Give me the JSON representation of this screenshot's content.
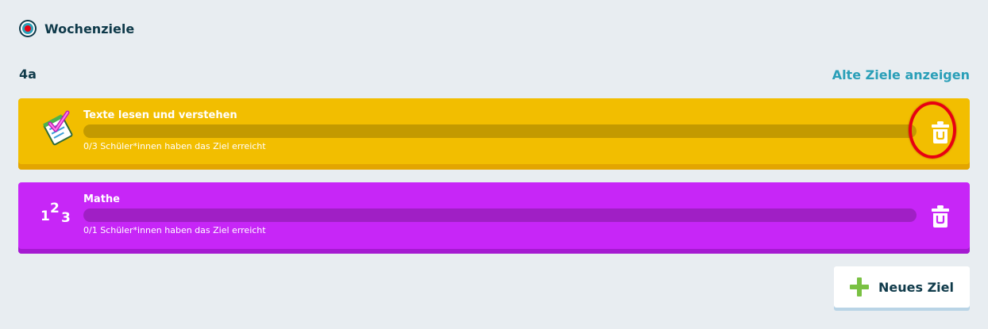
{
  "header": {
    "title": "Wochenziele",
    "icon": "target-icon"
  },
  "class_name": "4a",
  "links": {
    "old_goals": "Alte Ziele anzeigen"
  },
  "goals": [
    {
      "title": "Texte lesen und verstehen",
      "status": "0/3 Schüler*innen haben das Ziel erreicht",
      "achieved": 0,
      "total": 3,
      "progress": 0,
      "color": "#f2be00",
      "icon": "reading-checklist-icon"
    },
    {
      "title": "Mathe",
      "status": "0/1 Schüler*innen haben das Ziel erreicht",
      "achieved": 0,
      "total": 1,
      "progress": 0,
      "color": "#c726f7",
      "icon": "numbers-123-icon"
    }
  ],
  "actions": {
    "new_goal": "Neues Ziel",
    "delete_icon": "trash-icon",
    "add_icon": "plus-icon"
  },
  "colors": {
    "accent": "#2a9fb8",
    "text": "#0f3a4a",
    "highlight": "#e80012",
    "add_green": "#7ac143"
  }
}
